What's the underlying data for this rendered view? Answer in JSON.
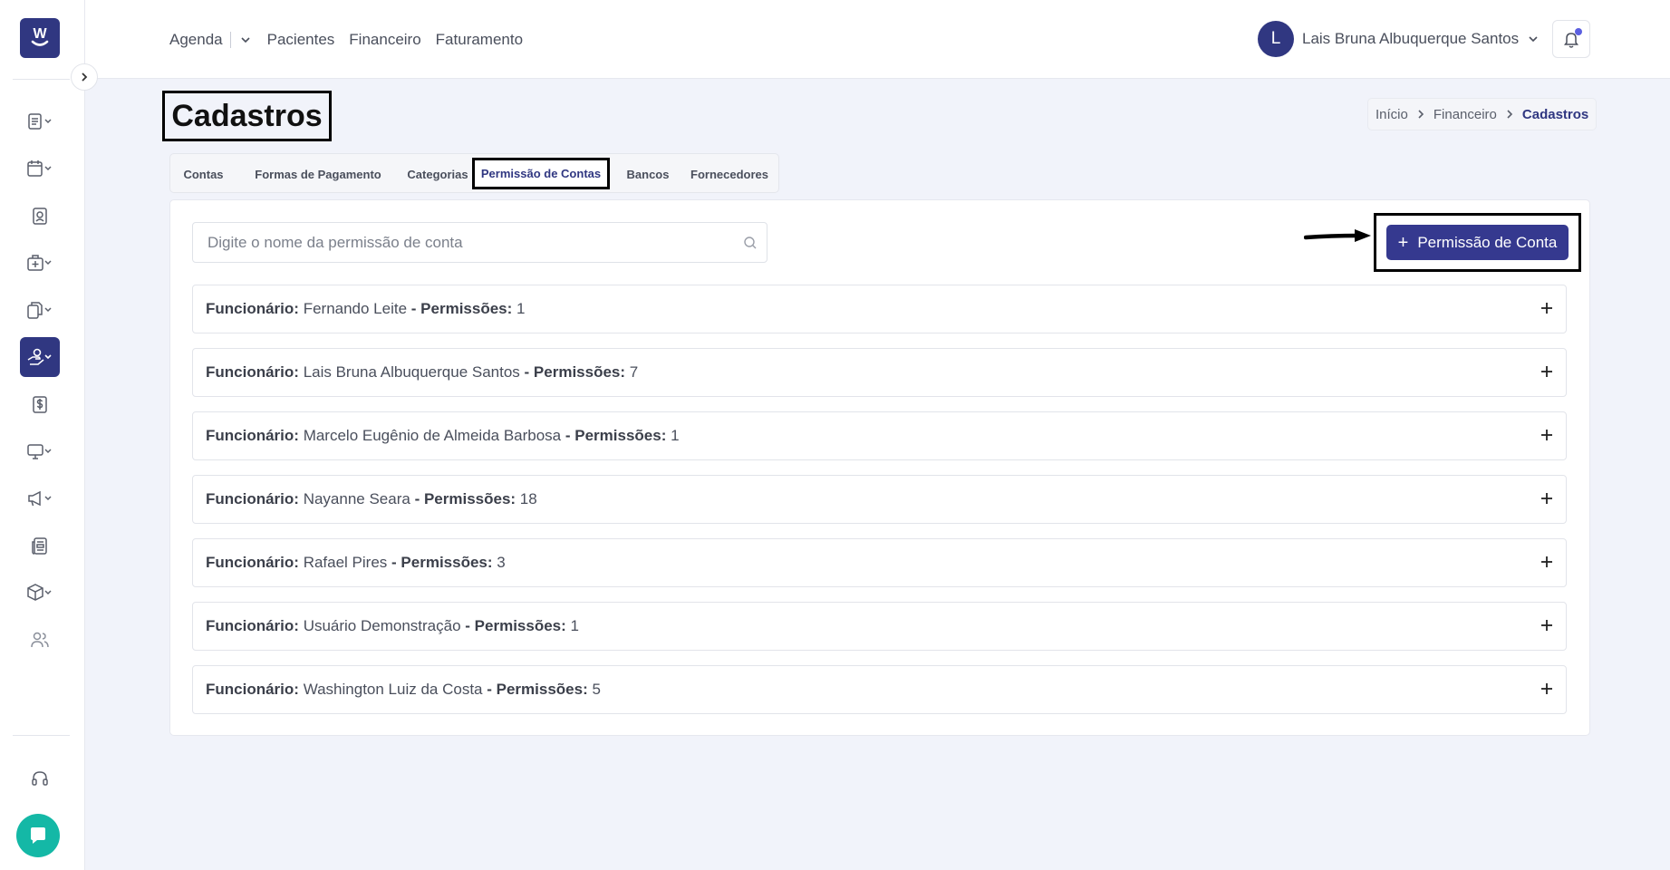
{
  "brand": {
    "logo_glyph": "W",
    "accent": "#303781",
    "chat_color": "#14b8a6"
  },
  "topnav": {
    "agenda": "Agenda",
    "pacientes": "Pacientes",
    "financeiro": "Financeiro",
    "faturamento": "Faturamento"
  },
  "user": {
    "initial": "L",
    "name": "Lais Bruna Albuquerque Santos"
  },
  "page": {
    "title": "Cadastros"
  },
  "breadcrumb": {
    "home": "Início",
    "section": "Financeiro",
    "current": "Cadastros"
  },
  "tabs": [
    {
      "label": "Contas"
    },
    {
      "label": "Formas de Pagamento"
    },
    {
      "label": "Categorias"
    },
    {
      "label": "Permissão de Contas",
      "active": true
    },
    {
      "label": "Bancos"
    },
    {
      "label": "Fornecedores"
    }
  ],
  "search": {
    "placeholder": "Digite o nome da permissão de conta",
    "value": ""
  },
  "add_button": {
    "plus": "+",
    "label": "Permissão de Conta"
  },
  "rows": [
    {
      "employee_label": "Funcionário:",
      "name": "Fernando Leite",
      "perm_label": "- Permissões:",
      "count": "1"
    },
    {
      "employee_label": "Funcionário:",
      "name": "Lais Bruna Albuquerque Santos",
      "perm_label": "- Permissões:",
      "count": "7"
    },
    {
      "employee_label": "Funcionário:",
      "name": "Marcelo Eugênio de Almeida Barbosa",
      "perm_label": "- Permissões:",
      "count": "1"
    },
    {
      "employee_label": "Funcionário:",
      "name": "Nayanne Seara",
      "perm_label": "- Permissões:",
      "count": "18"
    },
    {
      "employee_label": "Funcionário:",
      "name": "Rafael Pires",
      "perm_label": "- Permissões:",
      "count": "3"
    },
    {
      "employee_label": "Funcionário:",
      "name": "Usuário Demonstração",
      "perm_label": "- Permissões:",
      "count": "1"
    },
    {
      "employee_label": "Funcionário:",
      "name": "Washington Luiz da Costa",
      "perm_label": "- Permissões:",
      "count": "5"
    }
  ],
  "sidebar_icons": [
    "records-icon",
    "calendar-icon",
    "patient-badge-icon",
    "medical-kit-icon",
    "documents-icon",
    "finance-hand-icon",
    "dollar-icon",
    "monitor-icon",
    "megaphone-icon",
    "news-icon",
    "package-icon",
    "users-icon",
    "headset-icon",
    "chat-icon"
  ]
}
